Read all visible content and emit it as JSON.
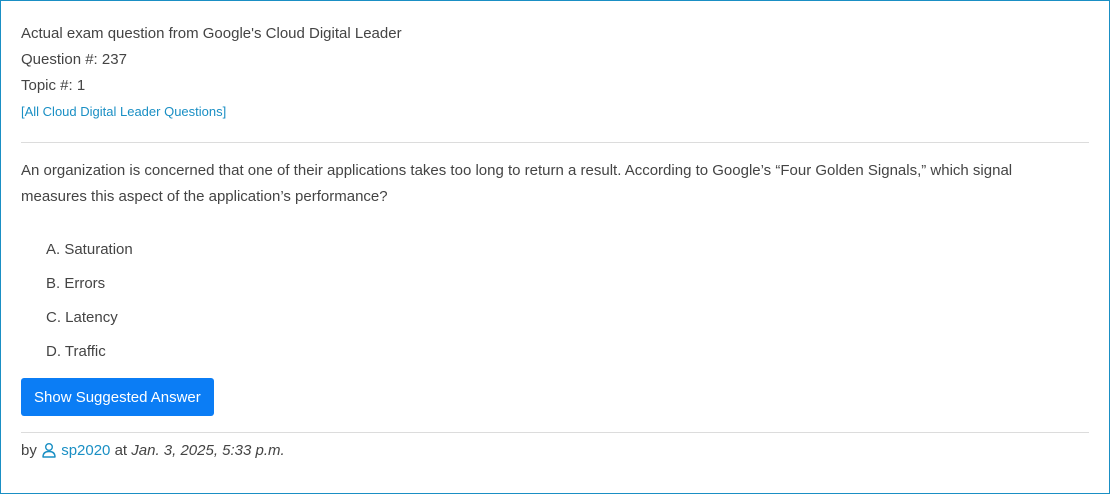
{
  "header": {
    "exam_line": "Actual exam question from Google's Cloud Digital Leader",
    "question_number": "Question #: 237",
    "topic": "Topic #: 1",
    "all_questions_link": "[All Cloud Digital Leader Questions]"
  },
  "question": {
    "text": "An organization is concerned that one of their applications takes too long to return a result. According to Google’s “Four Golden Signals,” which signal measures this aspect of the application’s performance?",
    "choices": [
      {
        "label": "A. Saturation"
      },
      {
        "label": "B. Errors"
      },
      {
        "label": "C. Latency"
      },
      {
        "label": "D. Traffic"
      }
    ]
  },
  "actions": {
    "show_answer_label": "Show Suggested Answer"
  },
  "meta": {
    "by_label": "by",
    "user_icon": "user-outline-icon",
    "username": "sp2020",
    "at_label": "at",
    "date": "Jan. 3, 2025, 5:33 p.m."
  },
  "colors": {
    "border": "#1a8fc4",
    "link": "#1a8fc4",
    "button": "#0b7df5",
    "text": "#444444"
  }
}
